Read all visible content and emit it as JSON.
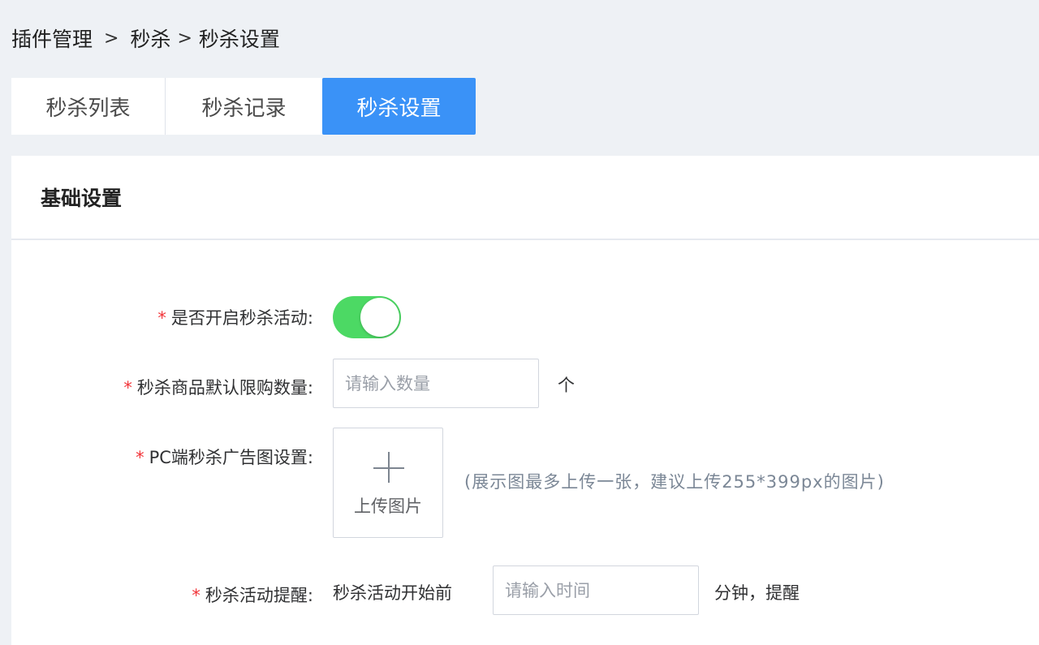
{
  "breadcrumb": {
    "item1": "插件管理",
    "sep1": ">",
    "item2": "秒杀",
    "sep2": ">",
    "item3": "秒杀设置"
  },
  "tabs": [
    {
      "label": "秒杀列表"
    },
    {
      "label": "秒杀记录"
    },
    {
      "label": "秒杀设置",
      "active": true
    }
  ],
  "panel": {
    "title": "基础设置"
  },
  "form": {
    "enable": {
      "star": "*",
      "label": "是否开启秒杀活动:",
      "checked": true
    },
    "limit": {
      "star": "*",
      "label": "秒杀商品默认限购数量:",
      "placeholder": "请输入数量",
      "value": "",
      "unit": "个"
    },
    "banner": {
      "star": "*",
      "label": "PC端秒杀广告图设置:",
      "upload_label": "上传图片",
      "hint": "(展示图最多上传一张，建议上传255*399px的图片)"
    },
    "remind": {
      "star": "*",
      "label": "秒杀活动提醒:",
      "prefix": "秒杀活动开始前",
      "placeholder": "请输入时间",
      "value": "",
      "suffix": "分钟，提醒"
    }
  },
  "colors": {
    "accent": "#3a92f7",
    "switch_on": "#4cd964",
    "required": "#f2353a",
    "background": "#eef1f5"
  },
  "icons": {
    "upload": "plus-icon"
  }
}
